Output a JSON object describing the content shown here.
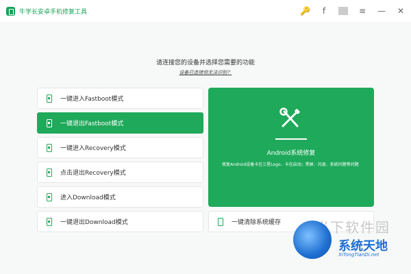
{
  "window": {
    "title": "牛学长安卓手机修复工具",
    "actions": [
      {
        "name": "key-icon",
        "glyph": "🔑"
      },
      {
        "name": "facebook-icon",
        "glyph": "f"
      },
      {
        "name": "menu-icon",
        "glyph": "≡"
      },
      {
        "name": "minimize-icon",
        "glyph": "—"
      },
      {
        "name": "close-icon",
        "glyph": "✕"
      }
    ]
  },
  "main": {
    "prompt": "请连接您的设备并选择您需要的功能",
    "prompt_link": "设备已连接但无法识别？",
    "buttons": [
      {
        "label": "一键进入Fastboot模式"
      },
      {
        "label": "一键退出Fastboot模式"
      },
      {
        "label": "一键进入Recovery模式"
      },
      {
        "label": "点击退出Recovery模式"
      },
      {
        "label": "进入Download模式"
      },
      {
        "label": "一键退出Download模式"
      }
    ],
    "repair": {
      "title": "Android系统修复",
      "description": "修复Android设备卡在三星Logo、卡在启动；黑屏、闪退、系统问题等问题"
    },
    "clear_cache": "一键清除系统缓存"
  },
  "watermark": {
    "text": "当下软件园",
    "logo_text": "系统天地",
    "url": "XiTongTianDi.net"
  },
  "colors": {
    "accent": "#1fa95a"
  }
}
